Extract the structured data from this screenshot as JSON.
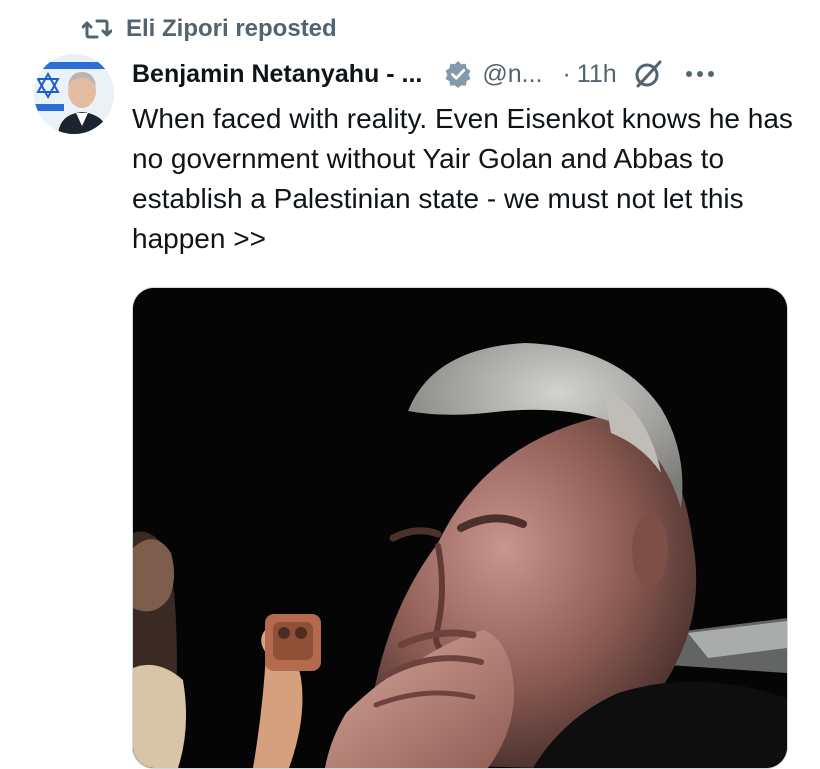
{
  "repost": {
    "label": "Eli Zipori reposted",
    "icon": "repost-icon"
  },
  "post": {
    "author_name": "Benjamin Netanyahu - ...",
    "handle": "@n...",
    "separator": "·",
    "time": "11h",
    "verified_icon": "verified-badge-icon",
    "grok_icon": "grok-icon",
    "more_icon": "more-options-icon",
    "text": "When faced with reality. Even Eisenkot knows he has no government without Yair Golan and Abbas to establish a Palestinian state - we must not let this happen >>",
    "media_icon": "video-thumbnail"
  },
  "colors": {
    "text_primary": "#0f1419",
    "text_secondary": "#536471",
    "verified": "#829aab",
    "media_background": "#050505"
  }
}
